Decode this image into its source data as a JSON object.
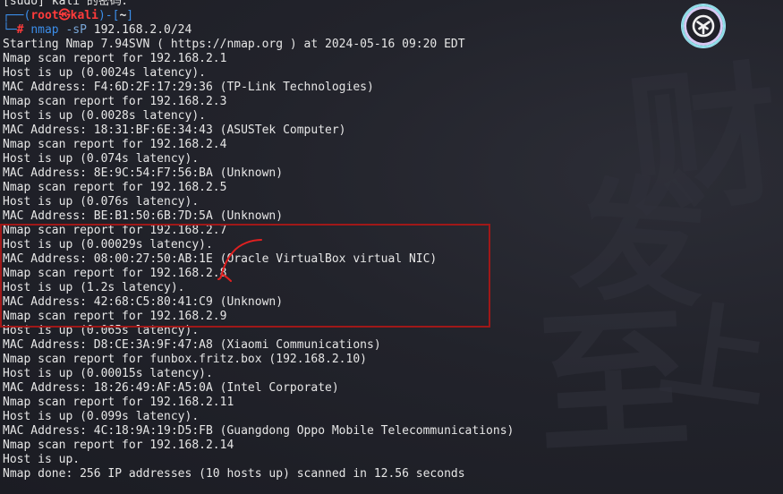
{
  "terminal": {
    "sudo_prompt": "[sudo] kali 的密码：",
    "prompt": {
      "corner_top": "┌──(",
      "user": "root",
      "at": "㉿",
      "host": "kali",
      "mid": ")-[",
      "dir": "~",
      "close": "]",
      "corner_bottom": "└─",
      "hash": "#",
      "command": "nmap",
      "flag": "-sP",
      "argument": "192.168.2.0/24"
    },
    "output_lines": [
      "Starting Nmap 7.94SVN ( https://nmap.org ) at 2024-05-16 09:20 EDT",
      "Nmap scan report for 192.168.2.1",
      "Host is up (0.0024s latency).",
      "MAC Address: F4:6D:2F:17:29:36 (TP-Link Technologies)",
      "Nmap scan report for 192.168.2.3",
      "Host is up (0.0028s latency).",
      "MAC Address: 18:31:BF:6E:34:43 (ASUSTek Computer)",
      "Nmap scan report for 192.168.2.4",
      "Host is up (0.074s latency).",
      "MAC Address: 8E:9C:54:F7:56:BA (Unknown)",
      "Nmap scan report for 192.168.2.5",
      "Host is up (0.076s latency).",
      "MAC Address: BE:B1:50:6B:7D:5A (Unknown)",
      "Nmap scan report for 192.168.2.7",
      "Host is up (0.00029s latency).",
      "MAC Address: 08:00:27:50:AB:1E (Oracle VirtualBox virtual NIC)",
      "Nmap scan report for 192.168.2.8",
      "Host is up (1.2s latency).",
      "MAC Address: 42:68:C5:80:41:C9 (Unknown)",
      "Nmap scan report for 192.168.2.9",
      "Host is up (0.065s latency).",
      "MAC Address: D8:CE:3A:9F:47:A8 (Xiaomi Communications)",
      "Nmap scan report for funbox.fritz.box (192.168.2.10)",
      "Host is up (0.00015s latency).",
      "MAC Address: 18:26:49:AF:A5:0A (Intel Corporate)",
      "Nmap scan report for 192.168.2.11",
      "Host is up (0.099s latency).",
      "MAC Address: 4C:18:9A:19:D5:FB (Guangdong Oppo Mobile Telecommunications)",
      "Nmap scan report for 192.168.2.14",
      "Host is up.",
      "Nmap done: 256 IP addresses (10 hosts up) scanned in 12.56 seconds"
    ]
  },
  "overlay": {
    "highlight_color": "#a01818",
    "annotation_color": "#e02020",
    "badge_icon": "app-logo-icon"
  },
  "background": {
    "watermark_glyphs": [
      "发",
      "财",
      "至",
      "上"
    ]
  }
}
